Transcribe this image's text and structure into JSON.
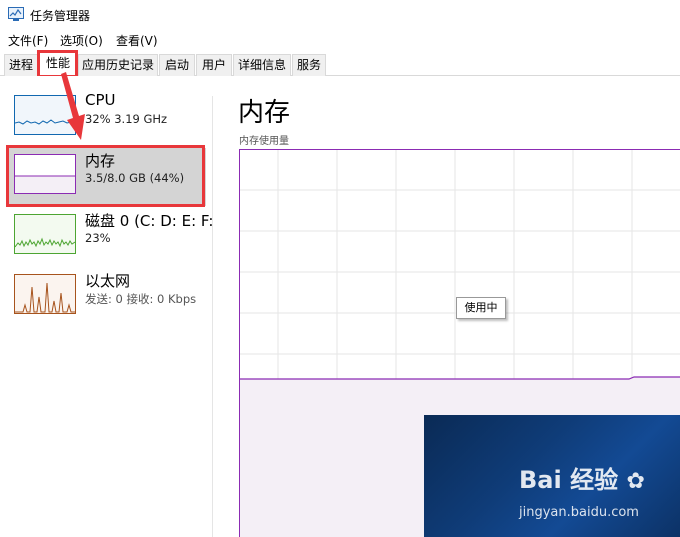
{
  "window": {
    "title": "任务管理器",
    "icon": "task-manager-icon"
  },
  "menu": {
    "items": [
      "文件(F)",
      "选项(O)",
      "查看(V)"
    ]
  },
  "tabs": {
    "items": [
      "进程",
      "性能",
      "应用历史记录",
      "启动",
      "用户",
      "详细信息",
      "服务"
    ],
    "active": "性能"
  },
  "sidebar": {
    "items": [
      {
        "title": "CPU",
        "subtitle": "32%  3.19 GHz",
        "color": "#1168b0"
      },
      {
        "title": "内存",
        "subtitle": "3.5/8.0 GB (44%)",
        "color": "#8b2bb3"
      },
      {
        "title": "磁盘 0 (C: D: E: F:",
        "subtitle": "23%",
        "color": "#4da532"
      },
      {
        "title": "以太网",
        "subtitle": "发送: 0  接收: 0 Kbps",
        "color": "#a7531d"
      }
    ],
    "selected": 1
  },
  "main": {
    "title": "内存",
    "chart_label": "内存使用量",
    "tooltip": "使用中",
    "usage_percent": 44
  },
  "annotations": {
    "highlight_color": "#e8373b"
  },
  "watermark": {
    "brand": "Bai 经验",
    "url": "jingyan.baidu.com"
  }
}
